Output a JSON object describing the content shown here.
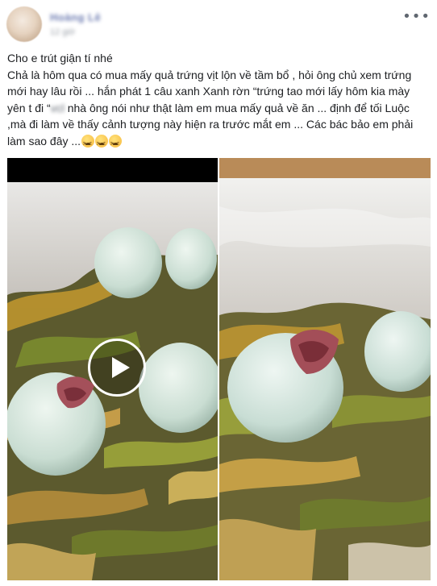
{
  "post": {
    "author_name": "Hoàng Lê",
    "timestamp": "12 giờ",
    "more_icon": "ellipsis-icon",
    "text_lines": [
      "Cho e trút giận tí nhé",
      "Chả là hôm qua có mua mấy quả trứng vịt lộn về tầm bổ , hỏi ông chủ xem trứng mới hay lâu rồi ... hắn phát 1 câu xanh Xanh rờn “trứng tao mới lấy hôm kia mày yên t đi “",
      "nhà ông nói như thật làm em mua mấy quả về ăn ... định để tối Luộc ,mà đi làm về thấy cảnh tượng này hiện ra trước mắt em ... Các bác bảo em phải làm sao đây ..."
    ],
    "censored_word": "vcl",
    "emoji_name": "tired-face-icon"
  },
  "media": {
    "left": {
      "type": "video",
      "play_icon": "play-icon"
    },
    "right": {
      "type": "photo"
    }
  },
  "colors": {
    "text": "#1c1e21",
    "secondary": "#606770",
    "link": "#385898"
  }
}
